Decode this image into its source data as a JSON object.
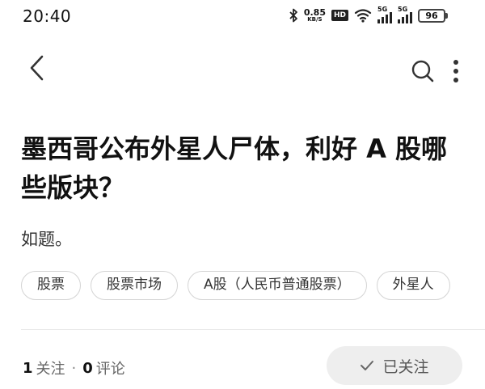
{
  "status_bar": {
    "time": "20:40",
    "net_speed_value": "0.85",
    "net_speed_unit": "KB/S",
    "hd_badge": "HD",
    "signal_1_label": "5G",
    "signal_2_label": "5G",
    "battery": "96"
  },
  "nav": {
    "back_icon": "chevron-left-icon",
    "search_icon": "search-icon",
    "more_icon": "more-vertical-icon"
  },
  "question": {
    "title": "墨西哥公布外星人尸体，利好 A 股哪些版块？",
    "description": "如题。"
  },
  "tags": [
    {
      "label": "股票"
    },
    {
      "label": "股票市场"
    },
    {
      "label": "A股（人民币普通股票）"
    },
    {
      "label": "外星人"
    }
  ],
  "stats": {
    "follow_count": "1",
    "follow_label": "关注",
    "separator": "·",
    "comment_count": "0",
    "comment_label": "评论"
  },
  "follow_button": {
    "label": "已关注",
    "icon": "check-icon"
  }
}
